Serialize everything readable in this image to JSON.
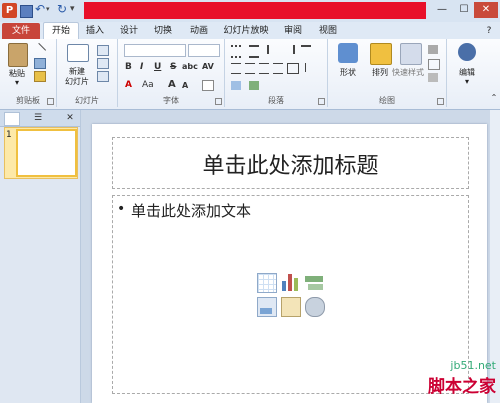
{
  "titlebar": {
    "app_logo": "P",
    "minimize": "—",
    "maximize": "☐",
    "close": "✕"
  },
  "tabs": {
    "file": "文件",
    "home": "开始",
    "insert": "插入",
    "design": "设计",
    "transitions": "切换",
    "animations": "动画",
    "slideshow": "幻灯片放映",
    "review": "审阅",
    "view": "视图",
    "help": "?"
  },
  "ribbon": {
    "clipboard": {
      "paste": "粘贴",
      "group": "剪贴板"
    },
    "slides": {
      "new_slide_line1": "新建",
      "new_slide_line2": "幻灯片",
      "group": "幻灯片"
    },
    "font": {
      "bold": "B",
      "italic": "I",
      "underline": "U",
      "strike": "S",
      "shadow": "abc",
      "spacing": "AV",
      "color": "A",
      "case": "Aa",
      "grow": "A",
      "shrink": "A",
      "group": "字体"
    },
    "paragraph": {
      "group": "段落"
    },
    "drawing": {
      "shapes": "形状",
      "arrange": "排列",
      "quick_styles": "快速样式",
      "group": "绘图"
    },
    "editing": {
      "edit": "编辑"
    }
  },
  "left_panel": {
    "slide_number": "1"
  },
  "slide": {
    "title_placeholder": "单击此处添加标题",
    "body_bullet": "•",
    "body_placeholder": "单击此处添加文本"
  },
  "watermark": {
    "url": "jb51.net",
    "name": "脚本之家"
  },
  "colors": {
    "title_red": "#e8102a",
    "file_tab": "#c8453a",
    "ribbon_bg": "#e8eef7",
    "thumb_border": "#f0c040"
  }
}
